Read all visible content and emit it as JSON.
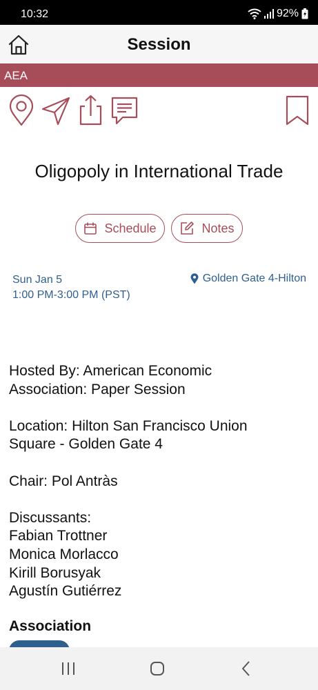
{
  "status_bar": {
    "time": "10:32",
    "battery": "92%"
  },
  "header": {
    "title": "Session"
  },
  "association_bar": {
    "label": "AEA"
  },
  "session": {
    "title": "Oligopoly in International Trade",
    "schedule_label": "Schedule",
    "notes_label": "Notes",
    "date": "Sun Jan 5",
    "time": "1:00 PM-3:00 PM (PST)",
    "location": "Golden Gate 4-Hilton"
  },
  "details": {
    "hosted_by_line1": "Hosted By: American Economic",
    "hosted_by_line2": "Association: Paper Session",
    "location_line1": "Location: Hilton San Francisco Union",
    "location_line2": "Square - Golden Gate 4",
    "chair": "Chair: Pol Antràs",
    "discussants_heading": "Discussants:",
    "discussants": [
      "Fabian Trottner",
      "Monica Morlacco",
      "Kirill Borusyak",
      "Agustín Gutiérrez"
    ]
  },
  "association_heading": "Association",
  "colors": {
    "accent": "#a64d59",
    "link": "#2e5f8f"
  }
}
